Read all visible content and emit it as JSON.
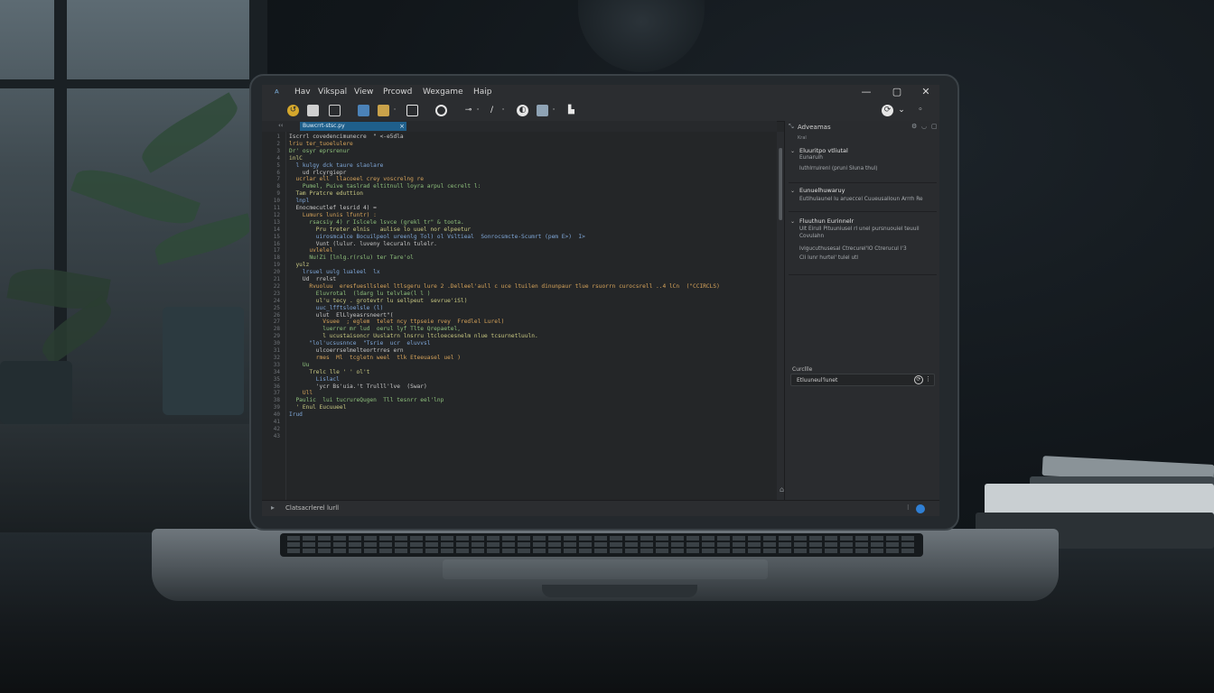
{
  "window": {
    "menus": [
      "Hav",
      "Vikspal",
      "View",
      "Prcowd",
      "Wexgame",
      "Haip"
    ],
    "controls": {
      "minimize": "—",
      "maximize": "▢",
      "close": "✕"
    }
  },
  "toolbar": {
    "icons": [
      "open-icon",
      "save-icon",
      "save-all-icon",
      "copy-icon",
      "paste-icon",
      "new-file-icon",
      "record-icon",
      "tools-icon",
      "edit-icon",
      "debug-icon",
      "build-icon",
      "deploy-icon",
      "run-icon"
    ]
  },
  "tab": {
    "label": "Buwcrrt-stsc.py",
    "nav": "‹‹",
    "close": "×"
  },
  "editor": {
    "line_numbers": [
      "1",
      "2",
      "3",
      "4",
      "5",
      "6",
      "7",
      "8",
      "9",
      "10",
      "11",
      "12",
      "13",
      "14",
      "15",
      "16",
      "17",
      "18",
      "19",
      "20",
      "21",
      "22",
      "23",
      "24",
      "25",
      "26",
      "27",
      "28",
      "29",
      "30",
      "31",
      "32",
      "33",
      "34",
      "35",
      "36",
      "37",
      "38",
      "39",
      "40",
      "41",
      "42",
      "43"
    ],
    "lines": [
      "Iscrrl covedencimunecre  \" <-e5dla",
      "lriu ter_tuoelulere",
      "Dr' osyr eprsrenur",
      "inlC",
      "  l kulgy dck taure slaolare",
      "    ud rlcyrgiepr",
      "  ucrlar ell  llacoeel crey voscrelng re",
      "    Pumel, Puive taslrad eltitnull loyra arpul cecrelt l:",
      "  Tam Pratcre eduttion",
      "  lnpl",
      "  Enocmecutlef lesrid 4) =",
      "    Lumurs lunis lfuntr) :",
      "      rsacsiy 4) r Islcele lsvce (grekl tr\" & toota.",
      "        Pru treter elnis   aulise lo uuel nor elpeetur",
      "        uirosmcalce Bocuilpeol ureenlg Tol) ol Vsltieal  Sonrocsmcte-Scumrt (pem E>)  I>",
      "        Vunt (lulur. luveny lecuraln tulelr.",
      "      uvlelel",
      "      Nu!Zi [lnlg.r(rslu) ter Tare'ol",
      "  yulz",
      "    lrsuel uulg lualeel  lx",
      "    Ud  rrelst",
      "      Rvuoluu  eresfuesllsleel ltlsgeru lure 2 .Delleel'aull c uce ltuilen dinunpaur tlue rsuorrn curocsrell ..4 lCn  (\"CCIRCLS)",
      "        Eluvrotal  (ldarg lu telvlae(l l )",
      "        ul'u tecy . grotevtr lu sellpeut  sevrue'iSl)",
      "        uuc_lfftsloelsle (l)",
      "        ulut  ElLlyeasrsneert\"(",
      "          Vsuee  ; eglem  telet ncy ttpseie rvey  Fredlel Lurel)",
      "          luerrer mr lud  oerul lyf Tlte Qrepaetel,",
      "          l ucustaisoncr Uuslatrn lnsrru ltcloecesnelm nlue tcsurnetluuln.",
      "      \"lol'ucsusnnce  \"Tsrie  ucr  eluvvsl",
      "        ulcoerrselmelteortrres ern",
      "        rmes  Ml  tcgletn weel  tlk Eteeuasel uel )",
      "    Uu",
      "      Trelc lle ' ' ol't",
      "        Lislacl",
      "        'ycr Bs'uia.'t Trulll'lve  (Swar)",
      "    Ull",
      "  Paulic  lui tucrureQugen  Tll tesnrr eel'lnp",
      "  ' Enul Eucuueel",
      "Irud",
      "",
      "",
      ""
    ]
  },
  "panel": {
    "title": "Adveamas",
    "subtitle": "Kral",
    "controls": [
      "⚙",
      "◡",
      "▢"
    ],
    "sections": [
      {
        "title": "Eluuritpo vtliutal",
        "lines": [
          "Eunaruih",
          "Iuthlrruirenl (pruni Sluna thul)"
        ]
      },
      {
        "title": "Eunuelhuwaruy",
        "lines": [
          "Eutihulaunel lu arueccel  Cuueusalloun  Arrrh Re"
        ]
      },
      {
        "title": "Fluuthun Eurinnelr",
        "lines": [
          "Ult Eirull   Pltuuniusel  rl unel pursnuouiel teuuil",
          "Covulahn",
          "Ivlgucuthusesal  Ctrecurel'lO  Ctrerucul l'3",
          "Cli lunr hurtel' tulel utl"
        ]
      }
    ],
    "field": {
      "label": "Curcllle",
      "value": "Etluuneul'lunet",
      "button": "⟳",
      "more": "⋮"
    }
  },
  "status": {
    "text": "Clatsacrlerel  lurll",
    "sep": "⁝"
  }
}
